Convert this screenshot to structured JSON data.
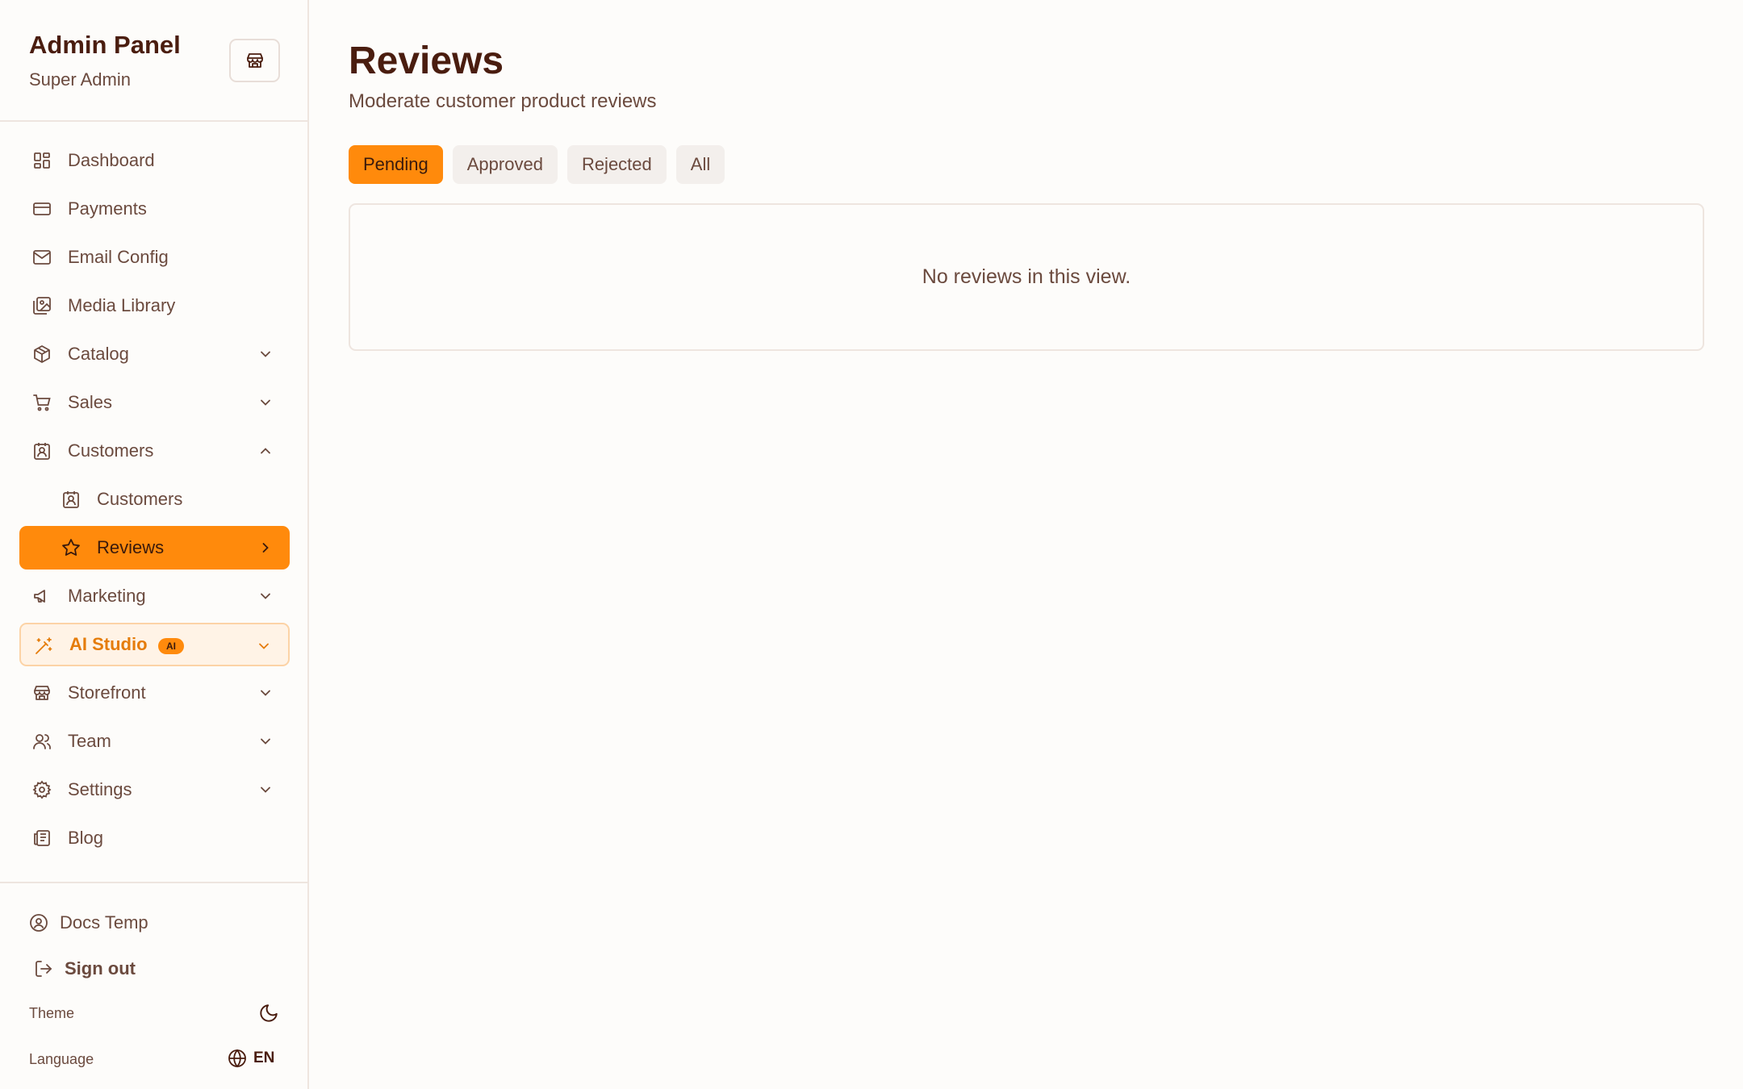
{
  "sidebar": {
    "title": "Admin Panel",
    "subtitle": "Super Admin",
    "items": [
      {
        "label": "Dashboard"
      },
      {
        "label": "Payments"
      },
      {
        "label": "Email Config"
      },
      {
        "label": "Media Library"
      },
      {
        "label": "Catalog"
      },
      {
        "label": "Sales"
      },
      {
        "label": "Customers"
      },
      {
        "label": "Customers"
      },
      {
        "label": "Reviews"
      },
      {
        "label": "Marketing"
      },
      {
        "label": "AI Studio",
        "badge": "AI"
      },
      {
        "label": "Storefront"
      },
      {
        "label": "Team"
      },
      {
        "label": "Settings"
      },
      {
        "label": "Blog"
      }
    ],
    "footer": {
      "user": "Docs Temp",
      "sign_out": "Sign out",
      "theme_label": "Theme",
      "language_label": "Language",
      "language_value": "EN"
    }
  },
  "main": {
    "title": "Reviews",
    "subtitle": "Moderate customer product reviews",
    "tabs": [
      {
        "label": "Pending",
        "active": true
      },
      {
        "label": "Approved",
        "active": false
      },
      {
        "label": "Rejected",
        "active": false
      },
      {
        "label": "All",
        "active": false
      }
    ],
    "empty_message": "No reviews in this view."
  },
  "colors": {
    "accent": "#ff8a0c",
    "accent_light": "#fff3e6",
    "text_dark": "#4a1d0f",
    "text": "#6b4a3e",
    "border": "#eee5df"
  }
}
